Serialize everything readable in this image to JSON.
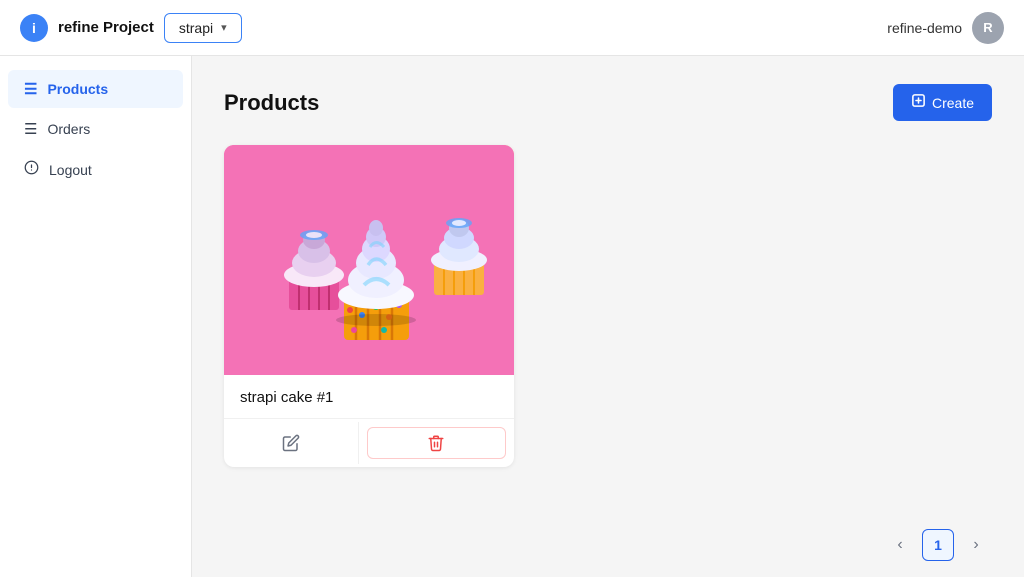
{
  "header": {
    "logo_letter": "i",
    "app_title": "refine Project",
    "dropdown_value": "strapi",
    "user_name": "refine-demo",
    "avatar_letter": "R"
  },
  "sidebar": {
    "items": [
      {
        "id": "products",
        "label": "Products",
        "icon": "≡",
        "active": true
      },
      {
        "id": "orders",
        "label": "Orders",
        "icon": "≡",
        "active": false
      },
      {
        "id": "logout",
        "label": "Logout",
        "icon": "↩",
        "active": false
      }
    ]
  },
  "main": {
    "page_title": "Products",
    "create_button_label": "Create",
    "products": [
      {
        "id": 1,
        "name": "strapi cake #1",
        "image_alt": "Cupcakes on pink background"
      }
    ]
  },
  "toolbar": {
    "create_icon": "＋"
  },
  "pagination": {
    "prev_label": "‹",
    "current_page": "1",
    "next_label": "›"
  }
}
